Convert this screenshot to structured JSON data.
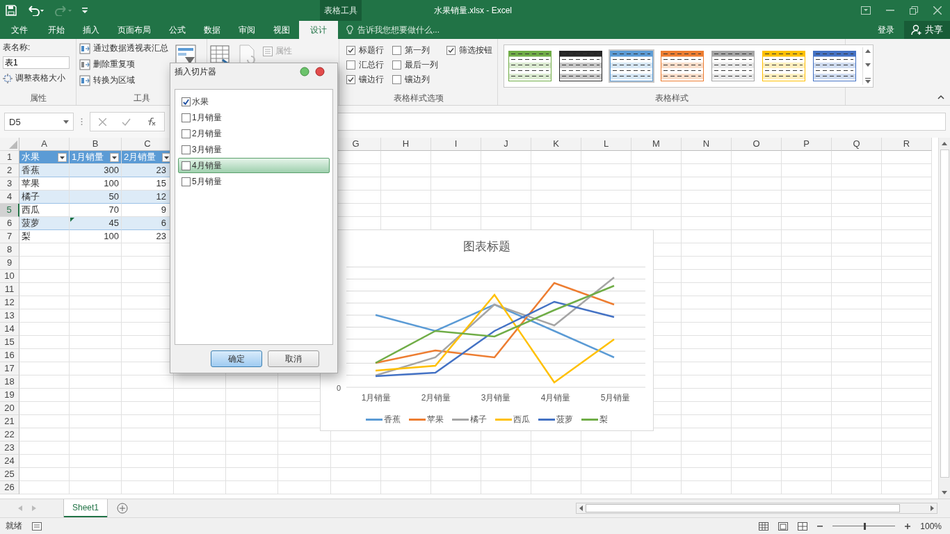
{
  "title_bar": {
    "contextual_tab": "表格工具",
    "title": "水果销量.xlsx - Excel"
  },
  "ribbon_tabs": [
    {
      "label": "文件",
      "selected": false
    },
    {
      "label": "开始",
      "selected": false
    },
    {
      "label": "插入",
      "selected": false
    },
    {
      "label": "页面布局",
      "selected": false
    },
    {
      "label": "公式",
      "selected": false
    },
    {
      "label": "数据",
      "selected": false
    },
    {
      "label": "审阅",
      "selected": false
    },
    {
      "label": "视图",
      "selected": false
    },
    {
      "label": "设计",
      "selected": true
    }
  ],
  "tell_me": {
    "placeholder": "告诉我您想要做什么..."
  },
  "account": {
    "sign_in": "登录",
    "share": "共享"
  },
  "ribbon": {
    "properties": {
      "name_label": "表名称:",
      "name_value": "表1",
      "resize": "调整表格大小",
      "group": "属性"
    },
    "tools": {
      "commands": [
        "通过数据透视表汇总",
        "删除重复项",
        "转换为区域"
      ],
      "group": "工具"
    },
    "external": {
      "properties": "属性"
    },
    "style_options": {
      "group": "表格样式选项",
      "options": [
        {
          "label": "标题行",
          "checked": true
        },
        {
          "label": "汇总行",
          "checked": false
        },
        {
          "label": "镶边行",
          "checked": true
        },
        {
          "label": "第一列",
          "checked": false
        },
        {
          "label": "最后一列",
          "checked": false
        },
        {
          "label": "镶边列",
          "checked": false
        },
        {
          "label": "筛选按钮",
          "checked": true
        }
      ]
    },
    "styles": {
      "group": "表格样式",
      "swatches": [
        {
          "color": "#70ad47",
          "selected": false
        },
        {
          "color": "#262626",
          "selected": false
        },
        {
          "color": "#5b9bd5",
          "selected": true
        },
        {
          "color": "#ed7d31",
          "selected": false
        },
        {
          "color": "#a5a5a5",
          "selected": false
        },
        {
          "color": "#ffc000",
          "selected": false
        },
        {
          "color": "#4472c4",
          "selected": false
        }
      ]
    }
  },
  "formula_bar": {
    "name_box": "D5"
  },
  "grid": {
    "columns_left": [
      "A",
      "B",
      "C"
    ],
    "columns_right": [
      "G",
      "H",
      "I",
      "J",
      "K",
      "L",
      "M",
      "N",
      "O",
      "P",
      "Q",
      "R"
    ],
    "rows": [
      {
        "label": "1",
        "selected": false
      },
      {
        "label": "2",
        "selected": false
      },
      {
        "label": "3",
        "selected": false
      },
      {
        "label": "4",
        "selected": false
      },
      {
        "label": "5",
        "selected": true
      },
      {
        "label": "6",
        "selected": false
      },
      {
        "label": "7",
        "selected": false
      },
      {
        "label": "8",
        "selected": false
      },
      {
        "label": "9",
        "selected": false
      },
      {
        "label": "10",
        "selected": false
      },
      {
        "label": "11",
        "selected": false
      },
      {
        "label": "12",
        "selected": false
      },
      {
        "label": "13",
        "selected": false
      },
      {
        "label": "14",
        "selected": false
      },
      {
        "label": "15",
        "selected": false
      },
      {
        "label": "16",
        "selected": false
      },
      {
        "label": "17",
        "selected": false
      },
      {
        "label": "18",
        "selected": false
      },
      {
        "label": "19",
        "selected": false
      },
      {
        "label": "20",
        "selected": false
      },
      {
        "label": "21",
        "selected": false
      },
      {
        "label": "22",
        "selected": false
      },
      {
        "label": "23",
        "selected": false
      },
      {
        "label": "24",
        "selected": false
      },
      {
        "label": "25",
        "selected": false
      },
      {
        "label": "26",
        "selected": false
      }
    ]
  },
  "table": {
    "header": [
      "水果",
      "1月销量",
      "2月销量"
    ],
    "rows": [
      [
        "香蕉",
        "300",
        "23"
      ],
      [
        "苹果",
        "100",
        "15"
      ],
      [
        "橘子",
        "50",
        "12"
      ],
      [
        "西瓜",
        "70",
        "9"
      ],
      [
        "菠萝",
        "45",
        "6"
      ],
      [
        "梨",
        "100",
        "23"
      ]
    ]
  },
  "dialog": {
    "title": "插入切片器",
    "ok": "确定",
    "cancel": "取消",
    "items": [
      {
        "label": "水果",
        "checked": true,
        "selected": false
      },
      {
        "label": "1月销量",
        "checked": false,
        "selected": false
      },
      {
        "label": "2月销量",
        "checked": false,
        "selected": false
      },
      {
        "label": "3月销量",
        "checked": false,
        "selected": false
      },
      {
        "label": "4月销量",
        "checked": false,
        "selected": true
      },
      {
        "label": "5月销量",
        "checked": false,
        "selected": false
      }
    ]
  },
  "chart": {
    "title": "图表标题",
    "axis_label": "0",
    "categories": [
      "1月销量",
      "2月销量",
      "3月销量",
      "4月销量",
      "5月销量"
    ],
    "legend": [
      {
        "name": "香蕉",
        "color": "#5b9bd5"
      },
      {
        "name": "苹果",
        "color": "#ed7d31"
      },
      {
        "name": "橘子",
        "color": "#a5a5a5"
      },
      {
        "name": "西瓜",
        "color": "#ffc000"
      },
      {
        "name": "菠萝",
        "color": "#4472c4"
      },
      {
        "name": "梨",
        "color": "#70ad47"
      }
    ]
  },
  "sheet_tabs": [
    {
      "label": "Sheet1",
      "selected": true
    }
  ],
  "status_bar": {
    "status": "就绪",
    "zoom": {
      "level": 0.5,
      "reading": "100%"
    }
  }
}
